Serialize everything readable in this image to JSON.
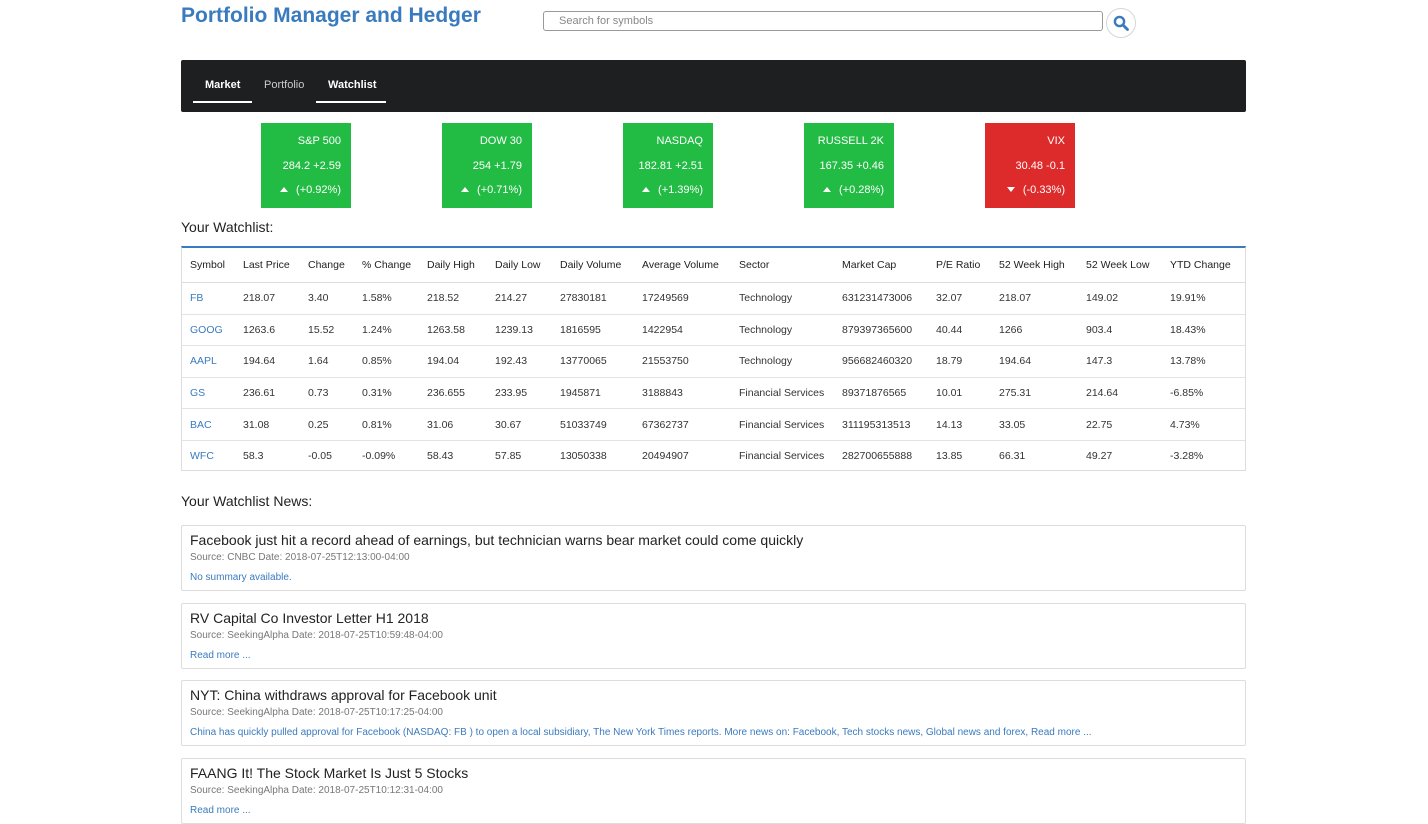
{
  "app": {
    "title": "Portfolio Manager and Hedger"
  },
  "search": {
    "placeholder": "Search for symbols",
    "button_icon": "search-icon"
  },
  "nav": {
    "tabs": [
      {
        "label": "Market",
        "active": true
      },
      {
        "label": "Portfolio",
        "active": false
      },
      {
        "label": "Watchlist",
        "active": true
      }
    ]
  },
  "indices": [
    {
      "name": "S&P 500",
      "value": "284.2 +2.59",
      "pct": "(+0.92%)",
      "direction": "up"
    },
    {
      "name": "DOW 30",
      "value": "254 +1.79",
      "pct": "(+0.71%)",
      "direction": "up"
    },
    {
      "name": "NASDAQ",
      "value": "182.81 +2.51",
      "pct": "(+1.39%)",
      "direction": "up"
    },
    {
      "name": "RUSSELL 2K",
      "value": "167.35 +0.46",
      "pct": "(+0.28%)",
      "direction": "up"
    },
    {
      "name": "VIX",
      "value": "30.48 -0.1",
      "pct": "(-0.33%)",
      "direction": "down"
    }
  ],
  "colors": {
    "up": "#22bb44",
    "down": "#dd2a2a",
    "accent": "#3a7bbf",
    "navbar": "#1e1f21"
  },
  "watchlist": {
    "heading": "Your Watchlist:",
    "columns": [
      "Symbol",
      "Last Price",
      "Change",
      "% Change",
      "Daily High",
      "Daily Low",
      "Daily Volume",
      "Average Volume",
      "Sector",
      "Market Cap",
      "P/E Ratio",
      "52 Week High",
      "52 Week Low",
      "YTD Change"
    ],
    "rows": [
      [
        "FB",
        "218.07",
        "3.40",
        "1.58%",
        "218.52",
        "214.27",
        "27830181",
        "17249569",
        "Technology",
        "631231473006",
        "32.07",
        "218.07",
        "149.02",
        "19.91%"
      ],
      [
        "GOOG",
        "1263.6",
        "15.52",
        "1.24%",
        "1263.58",
        "1239.13",
        "1816595",
        "1422954",
        "Technology",
        "879397365600",
        "40.44",
        "1266",
        "903.4",
        "18.43%"
      ],
      [
        "AAPL",
        "194.64",
        "1.64",
        "0.85%",
        "194.04",
        "192.43",
        "13770065",
        "21553750",
        "Technology",
        "956682460320",
        "18.79",
        "194.64",
        "147.3",
        "13.78%"
      ],
      [
        "GS",
        "236.61",
        "0.73",
        "0.31%",
        "236.655",
        "233.95",
        "1945871",
        "3188843",
        "Financial Services",
        "89371876565",
        "10.01",
        "275.31",
        "214.64",
        "-6.85%"
      ],
      [
        "BAC",
        "31.08",
        "0.25",
        "0.81%",
        "31.06",
        "30.67",
        "51033749",
        "67362737",
        "Financial Services",
        "311195313513",
        "14.13",
        "33.05",
        "22.75",
        "4.73%"
      ],
      [
        "WFC",
        "58.3",
        "-0.05",
        "-0.09%",
        "58.43",
        "57.85",
        "13050338",
        "20494907",
        "Financial Services",
        "282700655888",
        "13.85",
        "66.31",
        "49.27",
        "-3.28%"
      ]
    ]
  },
  "news": {
    "heading": "Your Watchlist News:",
    "items": [
      {
        "title": "Facebook just hit a record ahead of earnings, but technician warns bear market could come quickly",
        "meta": "Source: CNBC Date: 2018-07-25T12:13:00-04:00",
        "summary": "No summary available."
      },
      {
        "title": "RV Capital Co Investor Letter H1 2018",
        "meta": "Source: SeekingAlpha Date: 2018-07-25T10:59:48-04:00",
        "summary": "Read more ..."
      },
      {
        "title": "NYT: China withdraws approval for Facebook unit",
        "meta": "Source: SeekingAlpha Date: 2018-07-25T10:17:25-04:00",
        "summary": "China has quickly pulled approval for Facebook (NASDAQ: FB ) to open a local subsidiary, The New York Times reports. More news on: Facebook, Tech stocks news, Global news and forex, Read more ..."
      },
      {
        "title": "FAANG It! The Stock Market Is Just 5 Stocks",
        "meta": "Source: SeekingAlpha Date: 2018-07-25T10:12:31-04:00",
        "summary": "Read more ..."
      }
    ]
  }
}
